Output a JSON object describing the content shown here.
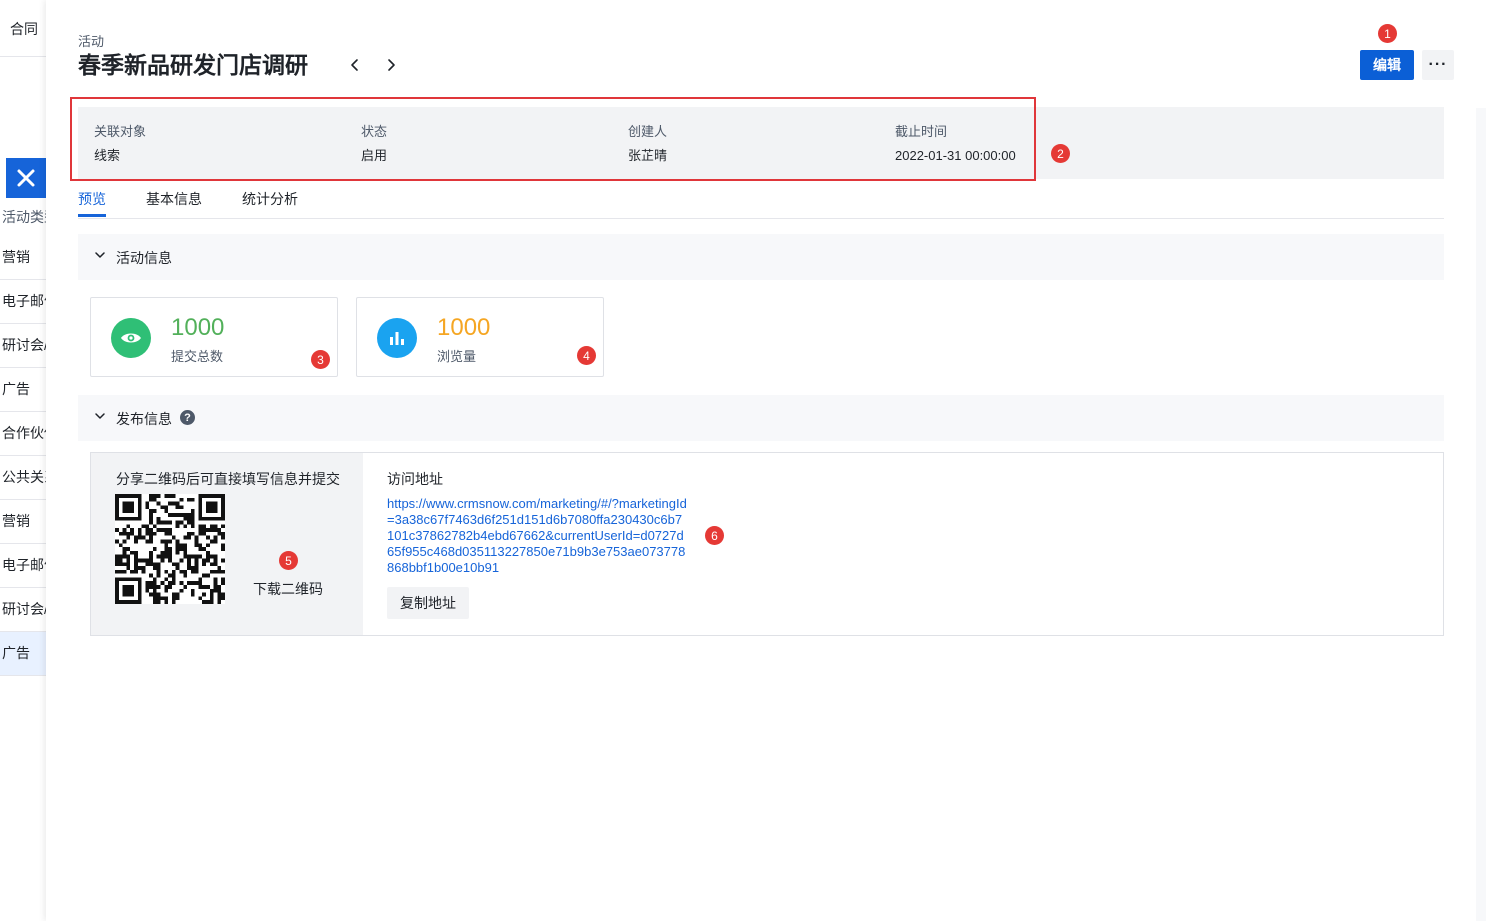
{
  "background": {
    "top_label": "合同",
    "column_header": "活动类型",
    "rows": [
      {
        "label": "营销"
      },
      {
        "label": "电子邮件"
      },
      {
        "label": "研讨会/展会"
      },
      {
        "label": "广告"
      },
      {
        "label": "合作伙伴"
      },
      {
        "label": "公共关系"
      },
      {
        "label": "营销"
      },
      {
        "label": "电子邮件"
      },
      {
        "label": "研讨会/展会"
      },
      {
        "label": "广告"
      }
    ]
  },
  "header": {
    "breadcrumb": "活动",
    "title": "春季新品研发门店调研",
    "edit_label": "编辑",
    "more_label": "···"
  },
  "info": {
    "items": [
      {
        "label": "关联对象",
        "value": "线索"
      },
      {
        "label": "状态",
        "value": "启用"
      },
      {
        "label": "创建人",
        "value": "张芷晴"
      },
      {
        "label": "截止时间",
        "value": "2022-01-31 00:00:00"
      }
    ]
  },
  "tabs": [
    {
      "label": "预览",
      "active": true
    },
    {
      "label": "基本信息",
      "active": false
    },
    {
      "label": "统计分析",
      "active": false
    }
  ],
  "sections": {
    "activity_info": "活动信息",
    "publish_info": "发布信息",
    "help_glyph": "?"
  },
  "stats": [
    {
      "value": "1000",
      "label": "提交总数",
      "color": "#52b05a",
      "icon_bg": "#2fbf76",
      "icon": "eye-icon"
    },
    {
      "value": "1000",
      "label": "浏览量",
      "color": "#f5a623",
      "icon_bg": "#1aa3f0",
      "icon": "bar-chart-icon"
    }
  ],
  "publish": {
    "qr_title": "分享二维码后可直接填写信息并提交",
    "download_label": "下载二维码",
    "url_label": "访问地址",
    "url": "https://www.crmsnow.com/marketing/#/?marketingId=3a38c67f7463d6f251d151d6b7080ffa230430c6b7101c37862782b4ebd67662&currentUserId=d0727d65f955c468d035113227850e71b9b3e753ae073778868bbf1b00e10b91",
    "copy_label": "复制地址"
  },
  "annotations": [
    "1",
    "2",
    "3",
    "4",
    "5",
    "6"
  ],
  "colors": {
    "primary": "#0b5fd6",
    "link": "#1664d9",
    "annotation": "#e53935"
  }
}
